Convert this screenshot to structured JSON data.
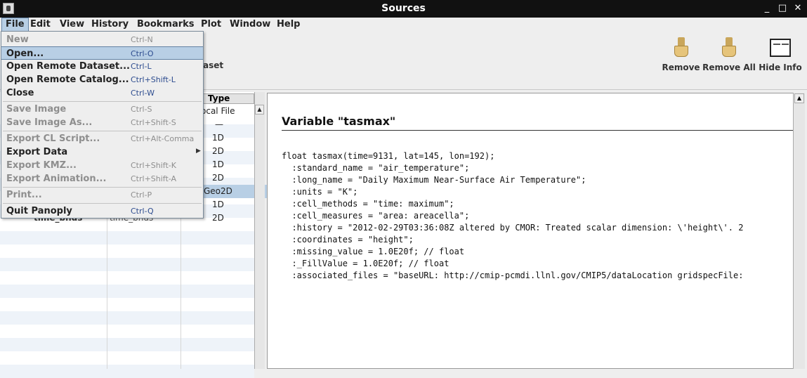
{
  "window": {
    "title": "Sources"
  },
  "menubar": [
    "File",
    "Edit",
    "View",
    "History",
    "Bookmarks",
    "Plot",
    "Window",
    "Help"
  ],
  "toolbar": {
    "partial_label": "aset",
    "remove_label": "Remove",
    "remove_all_label": "Remove All",
    "hide_info_label": "Hide Info"
  },
  "table": {
    "type_header": "Type",
    "types": [
      "ocal File",
      "—",
      "1D",
      "2D",
      "1D",
      "2D",
      "Geo2D",
      "1D",
      "2D"
    ],
    "partial_name": "time_bnds",
    "partial_name_type": "time_bnds"
  },
  "file_menu": {
    "items": [
      {
        "label": "New",
        "shortcut": "Ctrl-N",
        "enabled": false
      },
      {
        "label": "Open...",
        "shortcut": "Ctrl-O",
        "enabled": true,
        "highlighted": true
      },
      {
        "label": "Open Remote Dataset...",
        "shortcut": "Ctrl-L",
        "enabled": true
      },
      {
        "label": "Open Remote Catalog...",
        "shortcut": "Ctrl+Shift-L",
        "enabled": true
      },
      {
        "label": "Close",
        "shortcut": "Ctrl-W",
        "enabled": true
      },
      {
        "label": "Save Image",
        "shortcut": "Ctrl-S",
        "enabled": false
      },
      {
        "label": "Save Image As...",
        "shortcut": "Ctrl+Shift-S",
        "enabled": false
      },
      {
        "label": "Export CL Script...",
        "shortcut": "Ctrl+Alt-Comma",
        "enabled": false
      },
      {
        "label": "Export Data",
        "shortcut": "",
        "enabled": true,
        "submenu": true
      },
      {
        "label": "Export KMZ...",
        "shortcut": "Ctrl+Shift-K",
        "enabled": false
      },
      {
        "label": "Export Animation...",
        "shortcut": "Ctrl+Shift-A",
        "enabled": false
      },
      {
        "label": "Print...",
        "shortcut": "Ctrl-P",
        "enabled": false
      },
      {
        "label": "Quit Panoply",
        "shortcut": "Ctrl-Q",
        "enabled": true
      }
    ]
  },
  "info": {
    "title": "Variable \"tasmax\"",
    "lines": [
      "float tasmax(time=9131, lat=145, lon=192);",
      "  :standard_name = \"air_temperature\";",
      "  :long_name = \"Daily Maximum Near-Surface Air Temperature\";",
      "  :units = \"K\";",
      "  :cell_methods = \"time: maximum\";",
      "  :cell_measures = \"area: areacella\";",
      "  :history = \"2012-02-29T03:36:08Z altered by CMOR: Treated scalar dimension: \\'height\\'. 2",
      "  :coordinates = \"height\";",
      "  :missing_value = 1.0E20f; // float",
      "  :_FillValue = 1.0E20f; // float",
      "  :associated_files = \"baseURL: http://cmip-pcmdi.llnl.gov/CMIP5/dataLocation gridspecFile:"
    ]
  }
}
